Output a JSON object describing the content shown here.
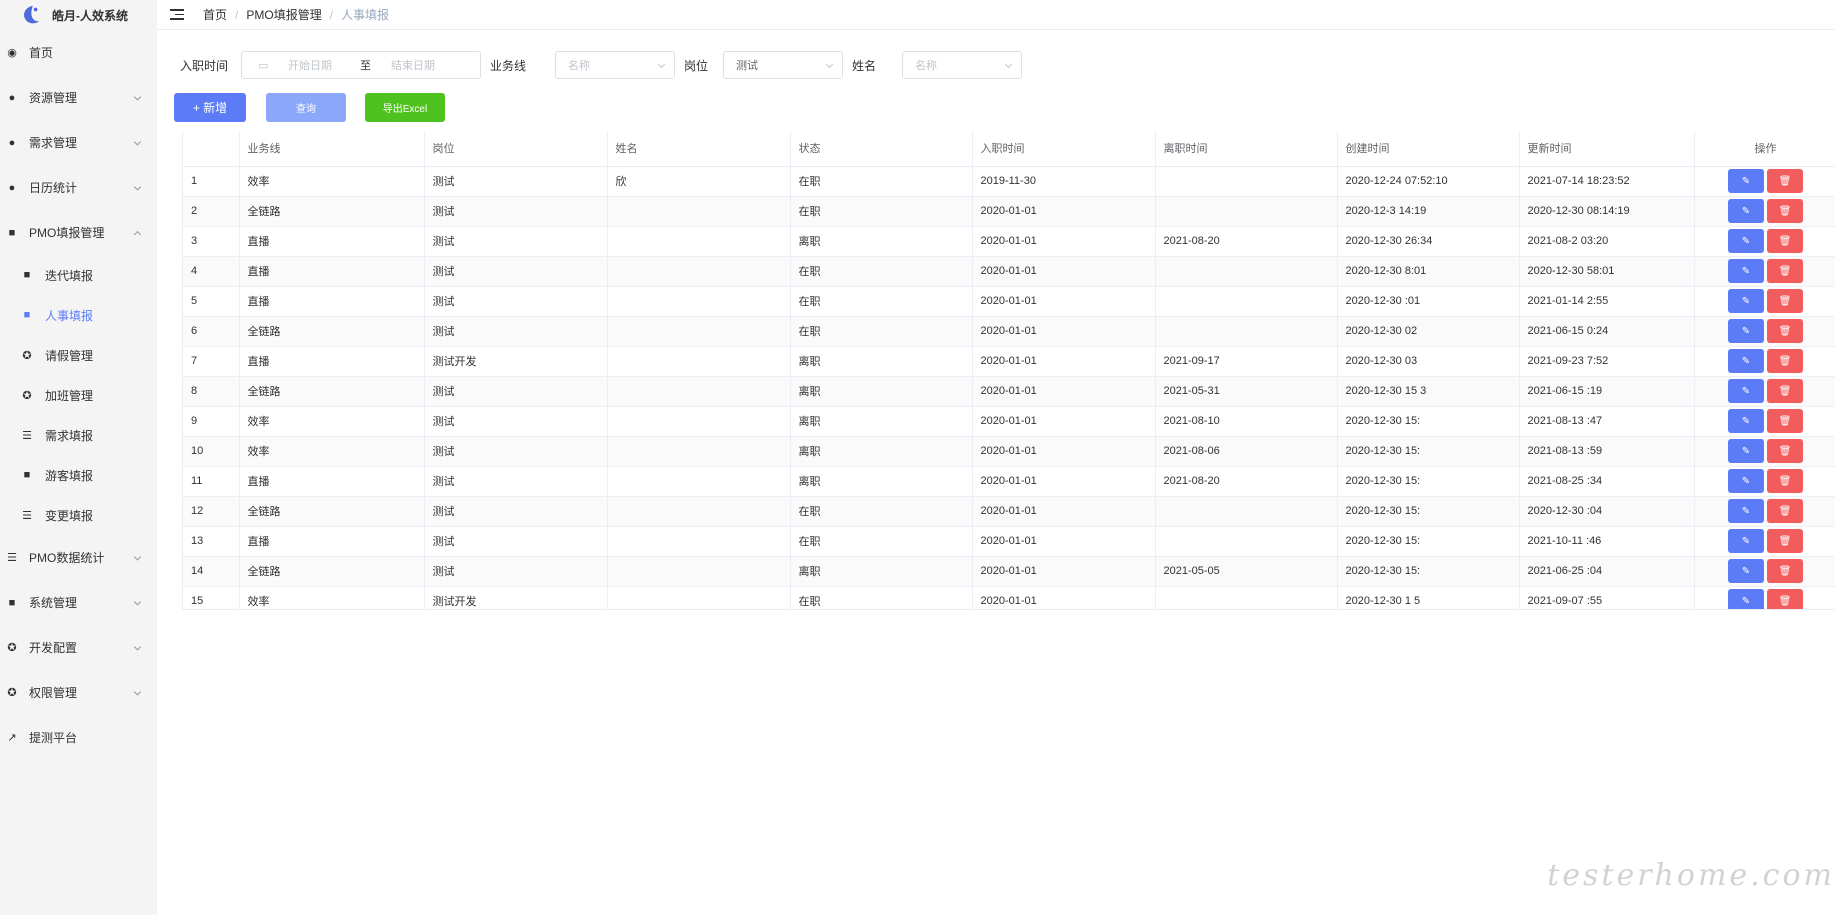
{
  "app": {
    "title": "皓月-人效系统"
  },
  "sidebar": {
    "items": [
      {
        "label": "首页",
        "icon": "dashboard-icon",
        "glyph": "◉",
        "has_children": false
      },
      {
        "label": "资源管理",
        "icon": "user-icon",
        "glyph": "●",
        "has_children": true
      },
      {
        "label": "需求管理",
        "icon": "user-icon",
        "glyph": "●",
        "has_children": true
      },
      {
        "label": "日历统计",
        "icon": "user-icon",
        "glyph": "●",
        "has_children": true
      },
      {
        "label": "PMO填报管理",
        "icon": "briefcase-icon",
        "glyph": "■",
        "has_children": true,
        "expanded": true
      },
      {
        "label": "PMO数据统计",
        "icon": "list-icon",
        "glyph": "☰",
        "has_children": true
      },
      {
        "label": "系统管理",
        "icon": "lock-icon",
        "glyph": "■",
        "has_children": true
      },
      {
        "label": "开发配置",
        "icon": "gear-icon",
        "glyph": "✪",
        "has_children": true
      },
      {
        "label": "权限管理",
        "icon": "gear-icon",
        "glyph": "✪",
        "has_children": true
      },
      {
        "label": "提测平台",
        "icon": "external-link-icon",
        "glyph": "↗",
        "has_children": false
      }
    ],
    "pmo_children": [
      {
        "label": "迭代填报",
        "icon": "briefcase-icon",
        "glyph": "■",
        "active": false
      },
      {
        "label": "人事填报",
        "icon": "briefcase-icon",
        "glyph": "■",
        "active": true
      },
      {
        "label": "请假管理",
        "icon": "gear-icon",
        "glyph": "✪",
        "active": false
      },
      {
        "label": "加班管理",
        "icon": "gear-icon",
        "glyph": "✪",
        "active": false
      },
      {
        "label": "需求填报",
        "icon": "list-icon",
        "glyph": "☰",
        "active": false
      },
      {
        "label": "游客填报",
        "icon": "briefcase-icon",
        "glyph": "■",
        "active": false
      },
      {
        "label": "变更填报",
        "icon": "list-icon",
        "glyph": "☰",
        "active": false
      }
    ]
  },
  "breadcrumb": [
    "首页",
    "PMO填报管理",
    "人事填报"
  ],
  "filters": {
    "hire_time_label": "入职时间",
    "start_placeholder": "开始日期",
    "range_separator": "至",
    "end_placeholder": "结束日期",
    "business_line_label": "业务线",
    "business_line_placeholder": "名称",
    "position_label": "岗位",
    "position_value": "测试",
    "name_label": "姓名",
    "name_placeholder": "名称"
  },
  "buttons": {
    "add": "+ 新增",
    "query": "查询",
    "export": "导出Excel"
  },
  "table": {
    "columns": [
      "",
      "业务线",
      "岗位",
      "姓名",
      "状态",
      "入职时间",
      "离职时间",
      "创建时间",
      "更新时间",
      "操作"
    ],
    "rows": [
      [
        "1",
        "效率",
        "测试",
        "欣",
        "在职",
        "2019-11-30",
        "",
        "2020-12-24 07:52:10",
        "2021-07-14 18:23:52"
      ],
      [
        "2",
        "全链路",
        "测试",
        "",
        "在职",
        "2020-01-01",
        "",
        "2020-12-3 14:19",
        "2020-12-30 08:14:19"
      ],
      [
        "3",
        "直播",
        "测试",
        "",
        "离职",
        "2020-01-01",
        "2021-08-20",
        "2020-12-30 26:34",
        "2021-08-2 03:20"
      ],
      [
        "4",
        "直播",
        "测试",
        "",
        "在职",
        "2020-01-01",
        "",
        "2020-12-30 8:01",
        "2020-12-30 58:01"
      ],
      [
        "5",
        "直播",
        "测试",
        "",
        "在职",
        "2020-01-01",
        "",
        "2020-12-30 :01",
        "2021-01-14 2:55"
      ],
      [
        "6",
        "全链路",
        "测试",
        "",
        "在职",
        "2020-01-01",
        "",
        "2020-12-30 02",
        "2021-06-15 0:24"
      ],
      [
        "7",
        "直播",
        "测试开发",
        "",
        "离职",
        "2020-01-01",
        "2021-09-17",
        "2020-12-30 03",
        "2021-09-23 7:52"
      ],
      [
        "8",
        "全链路",
        "测试",
        "",
        "离职",
        "2020-01-01",
        "2021-05-31",
        "2020-12-30 15 3",
        "2021-06-15 :19"
      ],
      [
        "9",
        "效率",
        "测试",
        "",
        "离职",
        "2020-01-01",
        "2021-08-10",
        "2020-12-30 15:",
        "2021-08-13 :47"
      ],
      [
        "10",
        "效率",
        "测试",
        "",
        "离职",
        "2020-01-01",
        "2021-08-06",
        "2020-12-30 15:",
        "2021-08-13 :59"
      ],
      [
        "11",
        "直播",
        "测试",
        "",
        "离职",
        "2020-01-01",
        "2021-08-20",
        "2020-12-30 15:",
        "2021-08-25 :34"
      ],
      [
        "12",
        "全链路",
        "测试",
        "",
        "在职",
        "2020-01-01",
        "",
        "2020-12-30 15:",
        "2020-12-30 :04"
      ],
      [
        "13",
        "直播",
        "测试",
        "",
        "在职",
        "2020-01-01",
        "",
        "2020-12-30 15:",
        "2021-10-11 :46"
      ],
      [
        "14",
        "全链路",
        "测试",
        "",
        "离职",
        "2020-01-01",
        "2021-05-05",
        "2020-12-30 15:",
        "2021-06-25 :04"
      ],
      [
        "15",
        "效率",
        "测试开发",
        "",
        "在职",
        "2020-01-01",
        "",
        "2020-12-30 1 5",
        "2021-09-07 :55"
      ]
    ],
    "edit_icon": "✎",
    "delete_icon": "🗑"
  },
  "colors": {
    "primary": "#5b7cf6",
    "danger": "#f25c5c",
    "success": "#4ec21e",
    "sidebar_bg": "#f4f4f5"
  },
  "watermark": "testerhome.com"
}
